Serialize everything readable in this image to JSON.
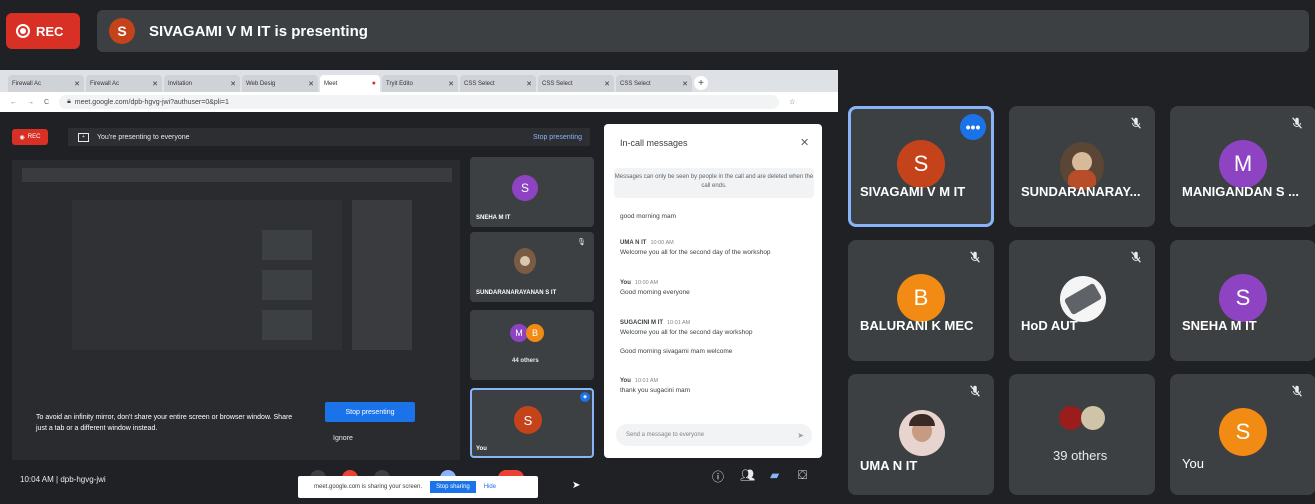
{
  "top": {
    "rec_label": "REC",
    "presenter_initial": "S",
    "presenter_text": "SIVAGAMI V M IT is presenting"
  },
  "colors": {
    "rec": "#d93025",
    "accent": "#1a73e8",
    "avatar_orange_red": "#c5431b",
    "avatar_orange": "#f28b13",
    "avatar_purple": "#8e44c2"
  },
  "shared_screen": {
    "tabs": [
      "Firewall Ac",
      "Firewall Ac",
      "Invitation",
      "Web Desig",
      "Meet",
      "Tryit Edito",
      "CSS Select",
      "CSS Select",
      "CSS Select"
    ],
    "url": "meet.google.com/dpb-hgvg-jwi?authuser=0&pli=1",
    "rec_label": "REC",
    "banner_text": "You're presenting to everyone",
    "stop_presenting_link": "Stop presenting",
    "mirror_warning": "To avoid an infinity mirror, don't share your entire screen or browser window. Share just a tab or a different window instead.",
    "stop_presenting_button": "Stop presenting",
    "ignore_button": "Ignore",
    "tiles": [
      {
        "initial": "S",
        "name": "SNEHA M IT"
      },
      {
        "initial": "",
        "name": "SUNDARANARAYANAN S IT"
      },
      {
        "initial": "M",
        "initial2": "B",
        "name": "44 others"
      },
      {
        "initial": "S",
        "name": "You"
      }
    ],
    "chat": {
      "title": "In-call messages",
      "info": "Messages can only be seen by people in the call and are deleted when the call ends.",
      "messages": [
        {
          "sender": "",
          "time": "",
          "text": "good morning mam"
        },
        {
          "sender": "UMA N IT",
          "time": "10:00 AM",
          "text": "Welcome you all for the second day of the workshop"
        },
        {
          "sender": "You",
          "time": "10:00 AM",
          "text": "Good morning everyone"
        },
        {
          "sender": "SUGACINI M IT",
          "time": "10:01 AM",
          "text": "Welcome you all for the second day workshop"
        },
        {
          "sender": "",
          "time": "",
          "text": "Good morning sivagami mam welcome"
        },
        {
          "sender": "You",
          "time": "10:01 AM",
          "text": "thank you sugacini mam"
        }
      ],
      "input_placeholder": "Send a message to everyone"
    },
    "meeting_info": "10:04 AM  |  dpb-hgvg-jwi",
    "sharing_text": "meet.google.com is sharing your screen.",
    "stop_sharing_button": "Stop sharing",
    "hide_link": "Hide"
  },
  "participants": [
    {
      "name": "SIVAGAMI V M IT",
      "initial": "S",
      "color": "#c5431b",
      "active": true,
      "muted": false,
      "type": "letter"
    },
    {
      "name": "SUNDARANARAY...",
      "initial": "",
      "color": "",
      "active": false,
      "muted": true,
      "type": "photo"
    },
    {
      "name": "MANIGANDAN S ...",
      "initial": "M",
      "color": "#8e44c2",
      "active": false,
      "muted": true,
      "type": "letter"
    },
    {
      "name": "BALURANI K MEC",
      "initial": "B",
      "color": "#f28b13",
      "active": false,
      "muted": true,
      "type": "letter"
    },
    {
      "name": "HoD AUT",
      "initial": "",
      "color": "",
      "active": false,
      "muted": true,
      "type": "photo"
    },
    {
      "name": "SNEHA M IT",
      "initial": "S",
      "color": "#8e44c2",
      "active": false,
      "muted": false,
      "type": "letter"
    },
    {
      "name": "UMA N IT",
      "initial": "",
      "color": "",
      "active": false,
      "muted": true,
      "type": "photo"
    },
    {
      "name": "39 others",
      "initial": "",
      "color": "",
      "active": false,
      "muted": false,
      "type": "group"
    },
    {
      "name": "You",
      "initial": "S",
      "color": "#f28b13",
      "active": false,
      "muted": true,
      "type": "letter"
    }
  ]
}
